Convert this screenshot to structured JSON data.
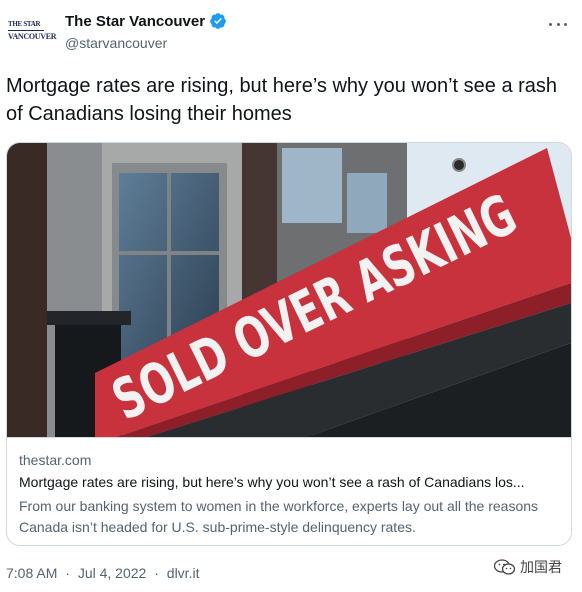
{
  "author": {
    "avatar_line1": "THE STAR",
    "avatar_line2": "VANCOUVER",
    "display_name": "The Star Vancouver",
    "handle": "@starvancouver",
    "verified_icon": "verified-badge-icon",
    "verified_color": "#1d9bf0"
  },
  "tweet": {
    "text": "Mortgage rates are rising, but here’s why you won’t see a rash of Canadians losing their homes"
  },
  "card": {
    "image_sign_text": "SOLD OVER ASKING",
    "domain": "thestar.com",
    "title": "Mortgage rates are rising, but here’s why you won’t see a rash of Canadians los...",
    "description": "From our banking system to women in the workforce, experts lay out all the reasons Canada isn’t headed for U.S. sub-prime-style delinquency rates."
  },
  "meta": {
    "time": "7:08 AM",
    "separator": "·",
    "date": "Jul 4, 2022",
    "source": "dlvr.it"
  },
  "watermark": {
    "text": "加国君"
  },
  "colors": {
    "text": "#0f1419",
    "secondary": "#536471",
    "border": "#cfd9de",
    "sign_red": "#c8323c"
  }
}
